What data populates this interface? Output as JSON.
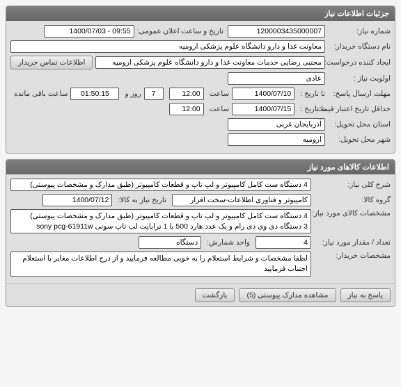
{
  "panel1": {
    "title": "جزئیات اطلاعات نیاز",
    "requestNumberLabel": "شماره نیاز:",
    "requestNumber": "1200003435000007",
    "announceDateLabel": "تاريخ و ساعت اعلان عمومی:",
    "announceDate": "09:55 - 1400/07/03",
    "orgNameLabel": "نام دستگاه خریدار:",
    "orgName": "معاونت غذا و دارو دانشگاه علوم پزشکی ارومیه",
    "requesterLabel": "ایجاد کننده درخواست:",
    "requester": "مجتبی رضایی خدمات معاونت غذا و دارو دانشگاه علوم پزشکی ارومیه",
    "contactBtn": "اطلاعات تماس خریدار",
    "priorityLabel": "اولویت نیاز :",
    "priority": "عادی",
    "deadlineLabel": "مهلت ارسال پاسخ:",
    "deadlineToLabel": "تا تاریخ :",
    "deadlineDate": "1400/07/10",
    "hourLabel": "ساعت",
    "deadlineHour": "12:00",
    "daysVal": "7",
    "daysLabel": "روز و",
    "countdown": "01:50:15",
    "countdownLabel": "ساعت باقی مانده",
    "validityLabel": "حداقل تاریخ اعتبار قیمت:",
    "validityToLabel": "تا تاریخ :",
    "validityDate": "1400/07/15",
    "validityHour": "12:00",
    "provinceLabel": "استان محل تحویل:",
    "province": "آذربایجان غربی",
    "cityLabel": "شهر محل تحویل:",
    "city": "ارومیه"
  },
  "panel2": {
    "title": "اطلاعات کالاهای مورد نیاز",
    "descLabel": "شرح کلی نیاز:",
    "desc": "4 دستگاه ست کامل کامپیوتر و لپ تاپ و قطعات کامپیوتر (طبق مدارک و مشخصات پیوستی)",
    "groupLabel": "گروه کالا:",
    "group": "کامپیوتر و فناوری اطلاعات-سخت افزار",
    "needDateLabel": "تاریخ نیاز به کالا:",
    "needDate": "1400/07/12",
    "specLabel": "مشخصات کالای مورد نیاز:",
    "spec": "4 دستگاه ست کامل کامپیوتر و لپ تاپ و قطعات کامپیوتر (طبق مدارک و مشخصات پیوستی)\n3 دستگاه دی وی دی رام و یک عدد هارد 500 با 1 ترابایت لب تاپ سونی sony  pcg-61911w",
    "qtyLabel": "تعداد / مقدار مورد نیاز:",
    "qty": "4",
    "unitLabel": "واحد شمارش:",
    "unit": "دستگاه",
    "notesLabel": "مشخصات خریدار:",
    "notes": "لطفا مشخصات  و شرایط استعلام را به خوبی مطالعه فرمایید و از درج اطلاعات مغایر با استعلام اجتناب فرمایید",
    "btnReply": "پاسخ به نیاز",
    "btnAttach": "مشاهده مدارک پیوستی (5)",
    "btnBack": "بازگشت"
  }
}
